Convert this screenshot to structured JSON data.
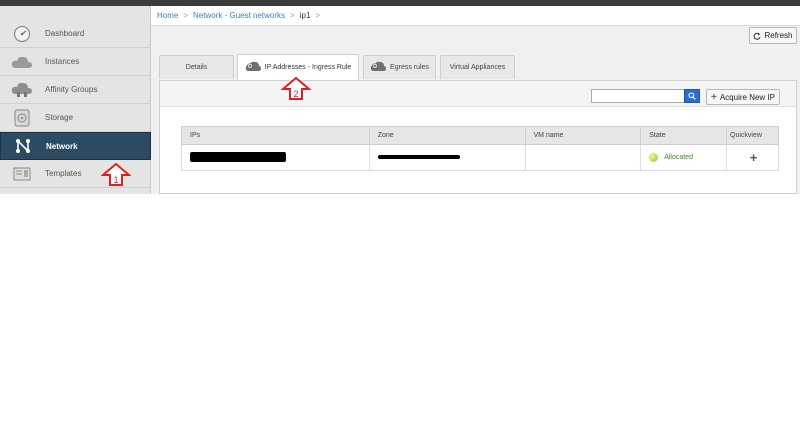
{
  "sidebar": {
    "items": [
      {
        "label": "Dashboard",
        "icon": "dashboard-gauge-icon",
        "active": false
      },
      {
        "label": "Instances",
        "icon": "cloud-icon",
        "active": false
      },
      {
        "label": "Affinity Groups",
        "icon": "affinity-cloud-icon",
        "active": false
      },
      {
        "label": "Storage",
        "icon": "storage-disk-icon",
        "active": false
      },
      {
        "label": "Network",
        "icon": "network-icon",
        "active": true
      },
      {
        "label": "Templates",
        "icon": "template-icon",
        "active": false
      }
    ]
  },
  "breadcrumb": {
    "home": "Home",
    "network": "Network - Guest networks",
    "current": "ip1",
    "separator": ">"
  },
  "toolbar": {
    "refresh_label": "Refresh"
  },
  "tabs": [
    {
      "label": "Details",
      "active": false
    },
    {
      "label": "IP Addresses - Ingress Rule",
      "active": true
    },
    {
      "label": "Egress rules",
      "active": false
    },
    {
      "label": "Virtual Appliances",
      "active": false
    }
  ],
  "search": {
    "placeholder": "",
    "value": ""
  },
  "acquire_label": "Acquire New IP",
  "table": {
    "columns": [
      "IPs",
      "Zone",
      "VM name",
      "State",
      "Quickview"
    ],
    "rows": [
      {
        "ip": "",
        "zone": "",
        "vm": "",
        "state": "Allocated",
        "quickview": "+"
      }
    ]
  },
  "annotations": {
    "marker1": "1",
    "marker2": "2"
  },
  "colors": {
    "accent": "#2c4b62",
    "link": "#3a82c4",
    "marker": "#e02020",
    "allocated": "#3a8a22"
  }
}
